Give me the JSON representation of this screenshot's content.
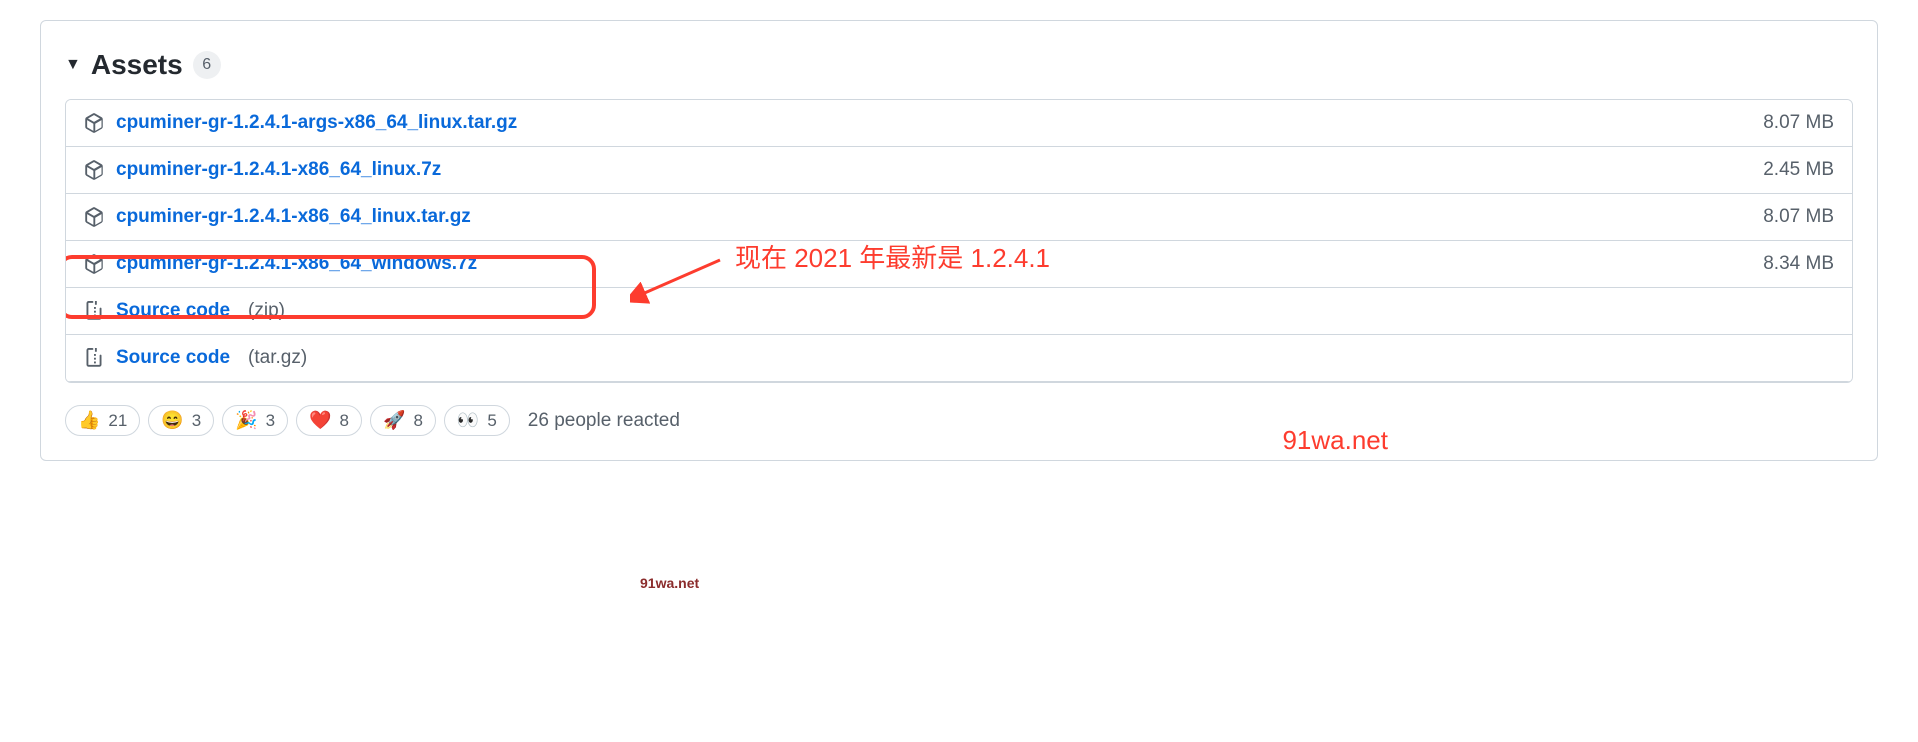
{
  "assets": {
    "title": "Assets",
    "count": "6",
    "items": [
      {
        "name": "cpuminer-gr-1.2.4.1-args-x86_64_linux.tar.gz",
        "size": "8.07 MB",
        "type": "package"
      },
      {
        "name": "cpuminer-gr-1.2.4.1-x86_64_linux.7z",
        "size": "2.45 MB",
        "type": "package"
      },
      {
        "name": "cpuminer-gr-1.2.4.1-x86_64_linux.tar.gz",
        "size": "8.07 MB",
        "type": "package"
      },
      {
        "name": "cpuminer-gr-1.2.4.1-x86_64_windows.7z",
        "size": "8.34 MB",
        "type": "package"
      },
      {
        "name": "Source code",
        "meta": "(zip)",
        "size": "",
        "type": "zip"
      },
      {
        "name": "Source code",
        "meta": "(tar.gz)",
        "size": "",
        "type": "zip"
      }
    ]
  },
  "reactions": {
    "items": [
      {
        "emoji": "👍",
        "count": "21"
      },
      {
        "emoji": "😄",
        "count": "3"
      },
      {
        "emoji": "🎉",
        "count": "3"
      },
      {
        "emoji": "❤️",
        "count": "8"
      },
      {
        "emoji": "🚀",
        "count": "8"
      },
      {
        "emoji": "👀",
        "count": "5"
      }
    ],
    "summary": "26 people reacted"
  },
  "annotations": {
    "text1": "现在 2021 年最新是 1.2.4.1",
    "watermark": "91wa.net",
    "watermark_small": "91wa.net"
  }
}
